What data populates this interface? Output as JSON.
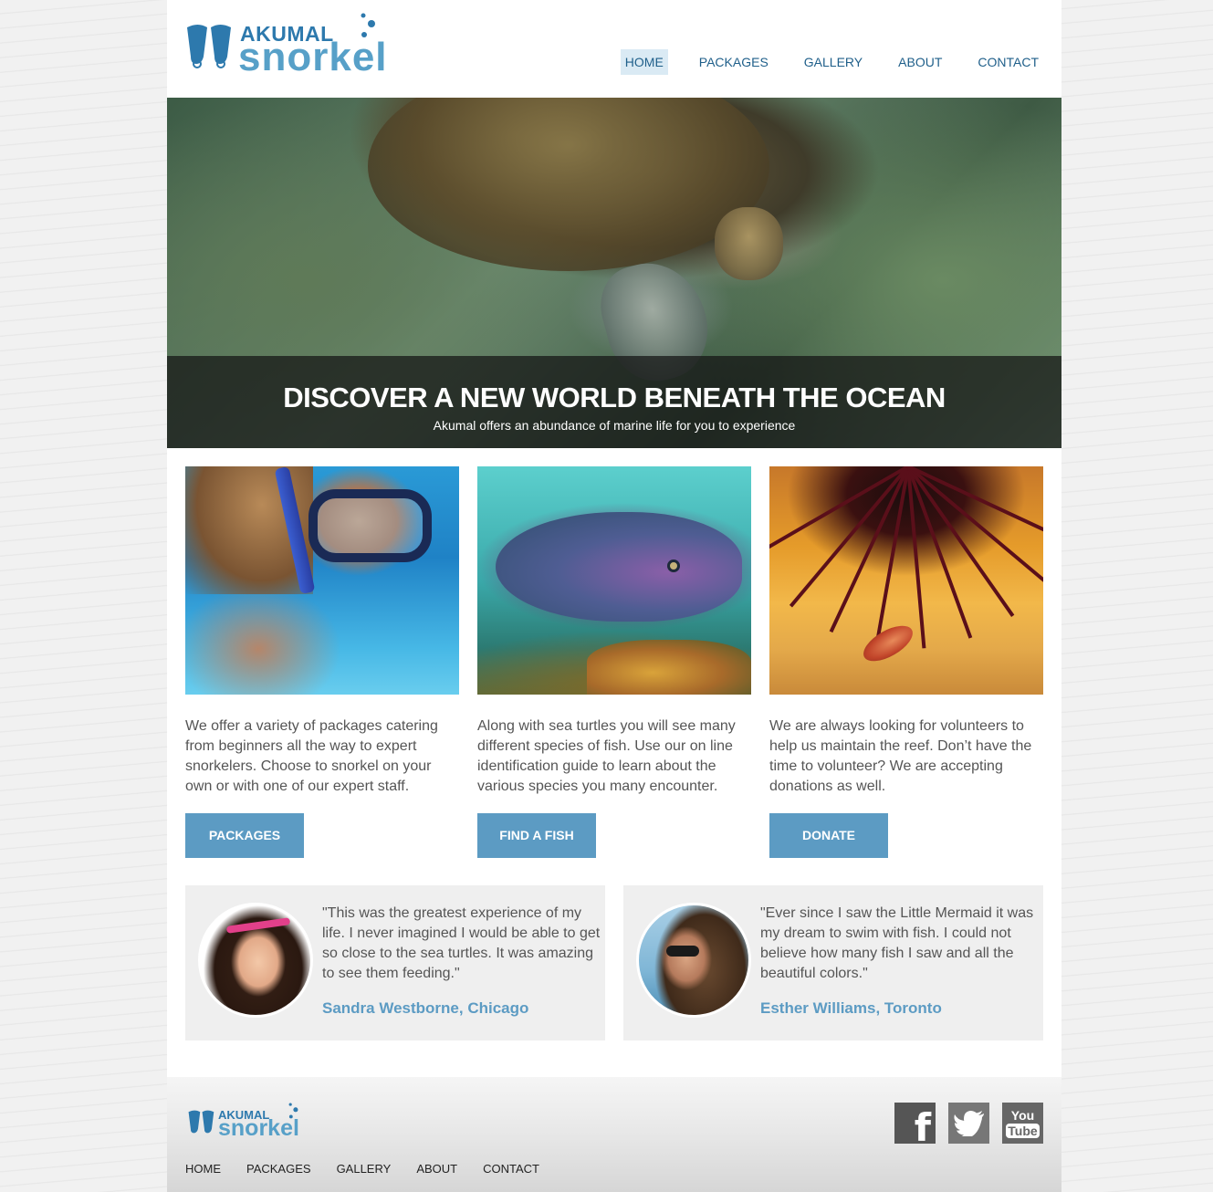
{
  "brand": {
    "line1": "AKUMAL",
    "line2": "snorkel",
    "color_dark": "#2d79ad",
    "color_light": "#57a0c8"
  },
  "nav": {
    "items": [
      {
        "label": "HOME",
        "active": true
      },
      {
        "label": "PACKAGES",
        "active": false
      },
      {
        "label": "GALLERY",
        "active": false
      },
      {
        "label": "ABOUT",
        "active": false
      },
      {
        "label": "CONTACT",
        "active": false
      }
    ]
  },
  "hero": {
    "title": "DISCOVER A NEW WORLD BENEATH THE OCEAN",
    "subtitle": "Akumal offers an abundance of marine life for you to experience"
  },
  "columns": [
    {
      "text": "We offer a variety of packages catering from beginners all the way to expert snorkelers. Choose to snorkel on your own or with one of our expert staff.",
      "button": "PACKAGES"
    },
    {
      "text": "Along with sea turtles you will see many different species of fish. Use our on line identification guide to learn about the various species you many encounter.",
      "button": "FIND A FISH"
    },
    {
      "text": "We are always looking for volunteers to help us maintain the reef. Don’t have the time to volunteer? We are accepting donations as well.",
      "button": "DONATE"
    }
  ],
  "testimonials": [
    {
      "quote": "\"This was the greatest experience of my life. I never imagined I would be able to get so close to the sea turtles. It was amazing to see them feeding.\"",
      "author": "Sandra Westborne, Chicago"
    },
    {
      "quote": "\"Ever since I saw the Little Mermaid it was my dream to swim with fish. I could not believe how many fish I saw and all the beautiful colors.\"",
      "author": "Esther Williams, Toronto"
    }
  ],
  "footer": {
    "nav": [
      "HOME",
      "PACKAGES",
      "GALLERY",
      "ABOUT",
      "CONTACT"
    ],
    "social": {
      "facebook": "f",
      "youtube_top": "You",
      "youtube_bottom": "Tube"
    }
  },
  "colors": {
    "accent": "#5c9bc3",
    "nav_text": "#1f5f8a",
    "active_bg": "#daeaf4"
  }
}
